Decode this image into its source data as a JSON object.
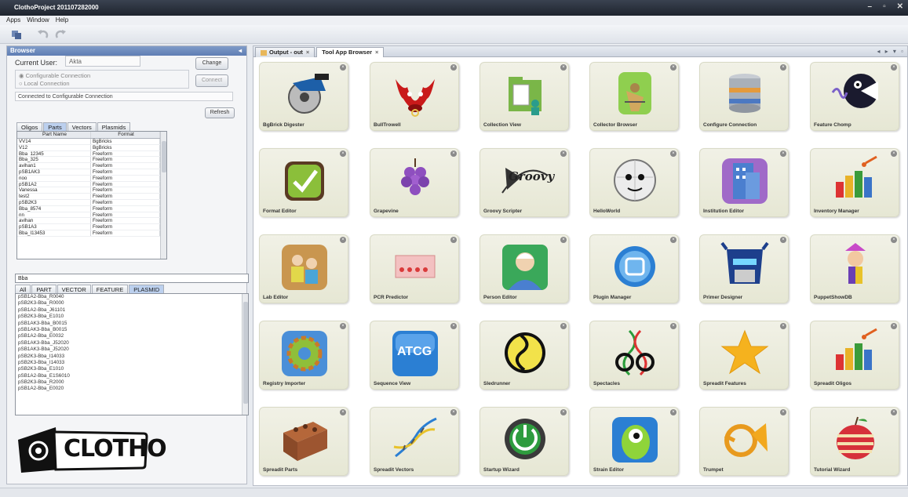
{
  "window": {
    "title": "ClothoProject 201107282000"
  },
  "menu": [
    "Apps",
    "Window",
    "Help"
  ],
  "browser": {
    "title": "Browser",
    "current_user_label": "Current User:",
    "current_user_value": "Akta",
    "change_button": "Change",
    "connect_button": "Connect",
    "radio_configurable": "Configurable Connection",
    "radio_local": "Local Connection",
    "status": "Connected to Configurable Connection",
    "refresh_button": "Refresh",
    "tabs": [
      "Oligos",
      "Parts",
      "Vectors",
      "Plasmids"
    ],
    "active_tab": "Parts",
    "table_headers": [
      "Part Name",
      "Format"
    ],
    "rows": [
      [
        "VV14",
        "BgBricks"
      ],
      [
        "V12",
        "BgBricks"
      ],
      [
        "Bba_12345",
        "Freeform"
      ],
      [
        "Bba_325",
        "Freeform"
      ],
      [
        "avihan1",
        "Freeform"
      ],
      [
        "pSB1AK3",
        "Freeform"
      ],
      [
        "noo",
        "Freeform"
      ],
      [
        "pSB1A2",
        "Freeform"
      ],
      [
        "Vanessa",
        "Freeform"
      ],
      [
        "test2",
        "Freeform"
      ],
      [
        "pSB2K3",
        "Freeform"
      ],
      [
        "Bba_8574",
        "Freeform"
      ],
      [
        "nn",
        "Freeform"
      ],
      [
        "avihan",
        "Freeform"
      ],
      [
        "pSB1A3",
        "Freeform"
      ],
      [
        "Bba_I13453",
        "Freeform"
      ]
    ],
    "search_value": "Bba",
    "filter_tabs": [
      "All",
      "PART",
      "VECTOR",
      "FEATURE",
      "PLASMID"
    ],
    "active_filter": "PLASMID",
    "plasmids": [
      "pSB1A2-Bba_R0040",
      "pSB2K3-Bba_R0000",
      "pSB1A2-Bba_J61101",
      "pSB2K3-Bba_E1010",
      "pSB1AK3-Bba_B0015",
      "pSB1AK3-Bba_B0015",
      "pSB1A2-Bba_E0032",
      "pSB1AK3-Bba_J52020",
      "pSB1AK3-Bba_J52020",
      "pSB2K3-Bba_I14033",
      "pSB2K3-Bba_I14033",
      "pSB2K3-Bba_E1010",
      "pSB1A2-Bba_E1S6010",
      "pSB2K3-Bba_R2000",
      "pSB1A2-Bba_E0020"
    ],
    "logo_text": "CLOTHO"
  },
  "main_tabs": [
    {
      "label": "Output - out",
      "close": "×"
    },
    {
      "label": "Tool App Browser",
      "close": "×"
    }
  ],
  "nav_arrows": "◂ ▸ ▾ ▫",
  "apps": [
    {
      "label": "BgBrick Digester",
      "icon": "circular-saw-icon"
    },
    {
      "label": "BullTrowell",
      "icon": "bull-icon"
    },
    {
      "label": "Collection View",
      "icon": "folder-people-icon"
    },
    {
      "label": "Collector Browser",
      "icon": "collector-icon"
    },
    {
      "label": "Configure Connection",
      "icon": "database-icon"
    },
    {
      "label": "Feature Chomp",
      "icon": "chomp-icon"
    },
    {
      "label": "Format Editor",
      "icon": "format-check-icon"
    },
    {
      "label": "Grapevine",
      "icon": "grapes-icon"
    },
    {
      "label": "Groovy Scripter",
      "icon": "groovy-icon"
    },
    {
      "label": "HelloWorld",
      "icon": "globe-face-icon"
    },
    {
      "label": "Institution Editor",
      "icon": "building-icon"
    },
    {
      "label": "Inventory Manager",
      "icon": "inventory-blocks-icon"
    },
    {
      "label": "Lab Editor",
      "icon": "lab-people-icon"
    },
    {
      "label": "PCR Predictor",
      "icon": "pcr-tubes-icon"
    },
    {
      "label": "Person Editor",
      "icon": "person-icon"
    },
    {
      "label": "Plugin Manager",
      "icon": "plugin-icon"
    },
    {
      "label": "Primer Designer",
      "icon": "robot-icon"
    },
    {
      "label": "PuppetShowDB",
      "icon": "puppet-icon"
    },
    {
      "label": "Registry Importer",
      "icon": "gear-icon"
    },
    {
      "label": "Sequence View",
      "icon": "atcg-icon"
    },
    {
      "label": "Sledrunner",
      "icon": "dna-sign-icon"
    },
    {
      "label": "Spectacles",
      "icon": "spectacles-icon"
    },
    {
      "label": "Spreadit Features",
      "icon": "star-icon"
    },
    {
      "label": "Spreadit Oligos",
      "icon": "inventory-blocks-icon"
    },
    {
      "label": "Spreadit Parts",
      "icon": "brick-icon"
    },
    {
      "label": "Spreadit Vectors",
      "icon": "dna-helix-icon"
    },
    {
      "label": "Startup Wizard",
      "icon": "power-icon"
    },
    {
      "label": "Strain Editor",
      "icon": "creature-icon"
    },
    {
      "label": "Trumpet",
      "icon": "horn-icon"
    },
    {
      "label": "Tutorial Wizard",
      "icon": "apple-icon"
    }
  ],
  "atcg_text": "ATCG",
  "groovy_text": "Groovy"
}
